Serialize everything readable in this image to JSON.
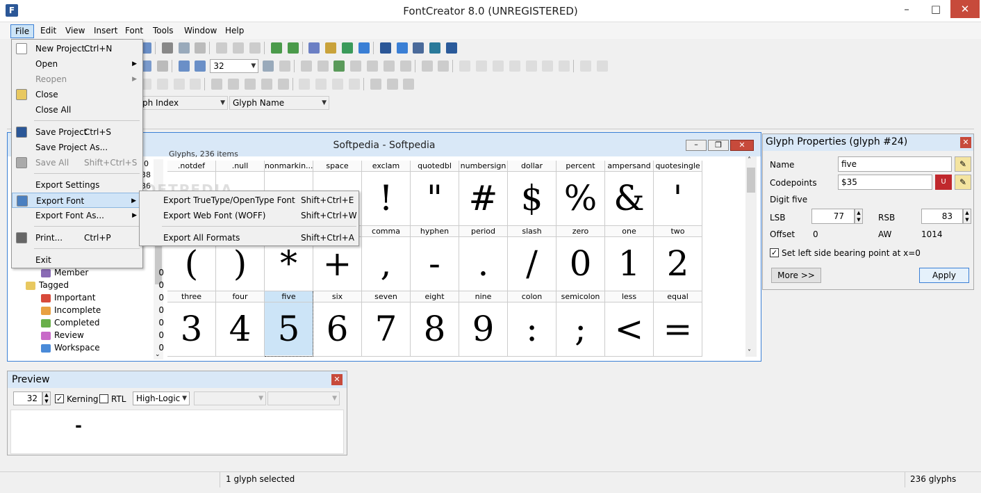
{
  "app": {
    "title": "FontCreator 8.0 (UNREGISTERED)"
  },
  "menubar": [
    "File",
    "Edit",
    "View",
    "Insert",
    "Font",
    "Tools",
    "Window",
    "Help"
  ],
  "toolbar": {
    "zoom": "32",
    "glyph_index_label": "ph Index",
    "glyph_name_label": "Glyph Name"
  },
  "file_menu": [
    {
      "label": "New Project...",
      "shortcut": "Ctrl+N",
      "disabled": false,
      "sub": false
    },
    {
      "label": "Open",
      "shortcut": "",
      "disabled": false,
      "sub": true
    },
    {
      "label": "Reopen",
      "shortcut": "",
      "disabled": true,
      "sub": true
    },
    {
      "label": "Close",
      "shortcut": "",
      "disabled": false,
      "sub": false
    },
    {
      "label": "Close All",
      "shortcut": "",
      "disabled": false,
      "sub": false
    },
    {
      "label": "Save Project",
      "shortcut": "Ctrl+S",
      "disabled": false,
      "sub": false
    },
    {
      "label": "Save Project As...",
      "shortcut": "",
      "disabled": false,
      "sub": false
    },
    {
      "label": "Save All",
      "shortcut": "Shift+Ctrl+S",
      "disabled": true,
      "sub": false
    },
    {
      "label": "Export Settings",
      "shortcut": "",
      "disabled": false,
      "sub": false
    },
    {
      "label": "Export Font",
      "shortcut": "",
      "disabled": false,
      "sub": true
    },
    {
      "label": "Export Font As...",
      "shortcut": "",
      "disabled": false,
      "sub": true
    },
    {
      "label": "Print...",
      "shortcut": "Ctrl+P",
      "disabled": false,
      "sub": false
    },
    {
      "label": "Exit",
      "shortcut": "",
      "disabled": false,
      "sub": false
    }
  ],
  "export_submenu": [
    {
      "label": "Export TrueType/OpenType Font",
      "shortcut": "Shift+Ctrl+E"
    },
    {
      "label": "Export Web Font (WOFF)",
      "shortcut": "Shift+Ctrl+W"
    },
    {
      "label": "Export All Formats",
      "shortcut": "Shift+Ctrl+A"
    }
  ],
  "tree": {
    "partial_counts": [
      "0",
      "38",
      "36"
    ],
    "items": [
      {
        "label": "Member",
        "count": "0"
      },
      {
        "label": "Tagged",
        "count": "0"
      },
      {
        "label": "Important",
        "count": "0"
      },
      {
        "label": "Incomplete",
        "count": "0"
      },
      {
        "label": "Completed",
        "count": "0"
      },
      {
        "label": "Review",
        "count": "0"
      },
      {
        "label": "Workspace",
        "count": "0"
      }
    ]
  },
  "glyph_window": {
    "title": "Softpedia - Softpedia",
    "header": "Glyphs, 236 items",
    "rows": [
      [
        {
          "n": ".notdef",
          "g": ""
        },
        {
          "n": ".null",
          "g": ""
        },
        {
          "n": "nonmarkin...",
          "g": ""
        },
        {
          "n": "space",
          "g": ""
        },
        {
          "n": "exclam",
          "g": "!"
        },
        {
          "n": "quotedbl",
          "g": "\""
        },
        {
          "n": "numbersign",
          "g": "#"
        },
        {
          "n": "dollar",
          "g": "$"
        },
        {
          "n": "percent",
          "g": "%"
        },
        {
          "n": "ampersand",
          "g": "&"
        },
        {
          "n": "quotesingle",
          "g": "'"
        }
      ],
      [
        {
          "n": "",
          "g": "("
        },
        {
          "n": "",
          "g": ")"
        },
        {
          "n": "",
          "g": "*"
        },
        {
          "n": "",
          "g": "+"
        },
        {
          "n": "comma",
          "g": ","
        },
        {
          "n": "hyphen",
          "g": "-"
        },
        {
          "n": "period",
          "g": "."
        },
        {
          "n": "slash",
          "g": "/"
        },
        {
          "n": "zero",
          "g": "0"
        },
        {
          "n": "one",
          "g": "1"
        },
        {
          "n": "two",
          "g": "2"
        }
      ],
      [
        {
          "n": "three",
          "g": "3"
        },
        {
          "n": "four",
          "g": "4"
        },
        {
          "n": "five",
          "g": "5"
        },
        {
          "n": "six",
          "g": "6"
        },
        {
          "n": "seven",
          "g": "7"
        },
        {
          "n": "eight",
          "g": "8"
        },
        {
          "n": "nine",
          "g": "9"
        },
        {
          "n": "colon",
          "g": ":"
        },
        {
          "n": "semicolon",
          "g": ";"
        },
        {
          "n": "less",
          "g": "<"
        },
        {
          "n": "equal",
          "g": "="
        }
      ]
    ],
    "selected": "five"
  },
  "glyph_props": {
    "title": "Glyph Properties (glyph #24)",
    "name_label": "Name",
    "name_value": "five",
    "codepoints_label": "Codepoints",
    "codepoints_value": "$35",
    "description": "Digit five",
    "lsb_label": "LSB",
    "lsb_value": "77",
    "rsb_label": "RSB",
    "rsb_value": "83",
    "offset_label": "Offset",
    "offset_value": "0",
    "aw_label": "AW",
    "aw_value": "1014",
    "checkbox_label": "Set left side bearing point at x=0",
    "more_label": "More >>",
    "apply_label": "Apply"
  },
  "preview": {
    "title": "Preview",
    "size": "32",
    "kerning_label": "Kerning",
    "rtl_label": "RTL",
    "layout": "High-Logic",
    "text": "-"
  },
  "status": {
    "selected": "1 glyph selected",
    "count": "236 glyphs"
  },
  "watermark": "SOFTPEDIA"
}
